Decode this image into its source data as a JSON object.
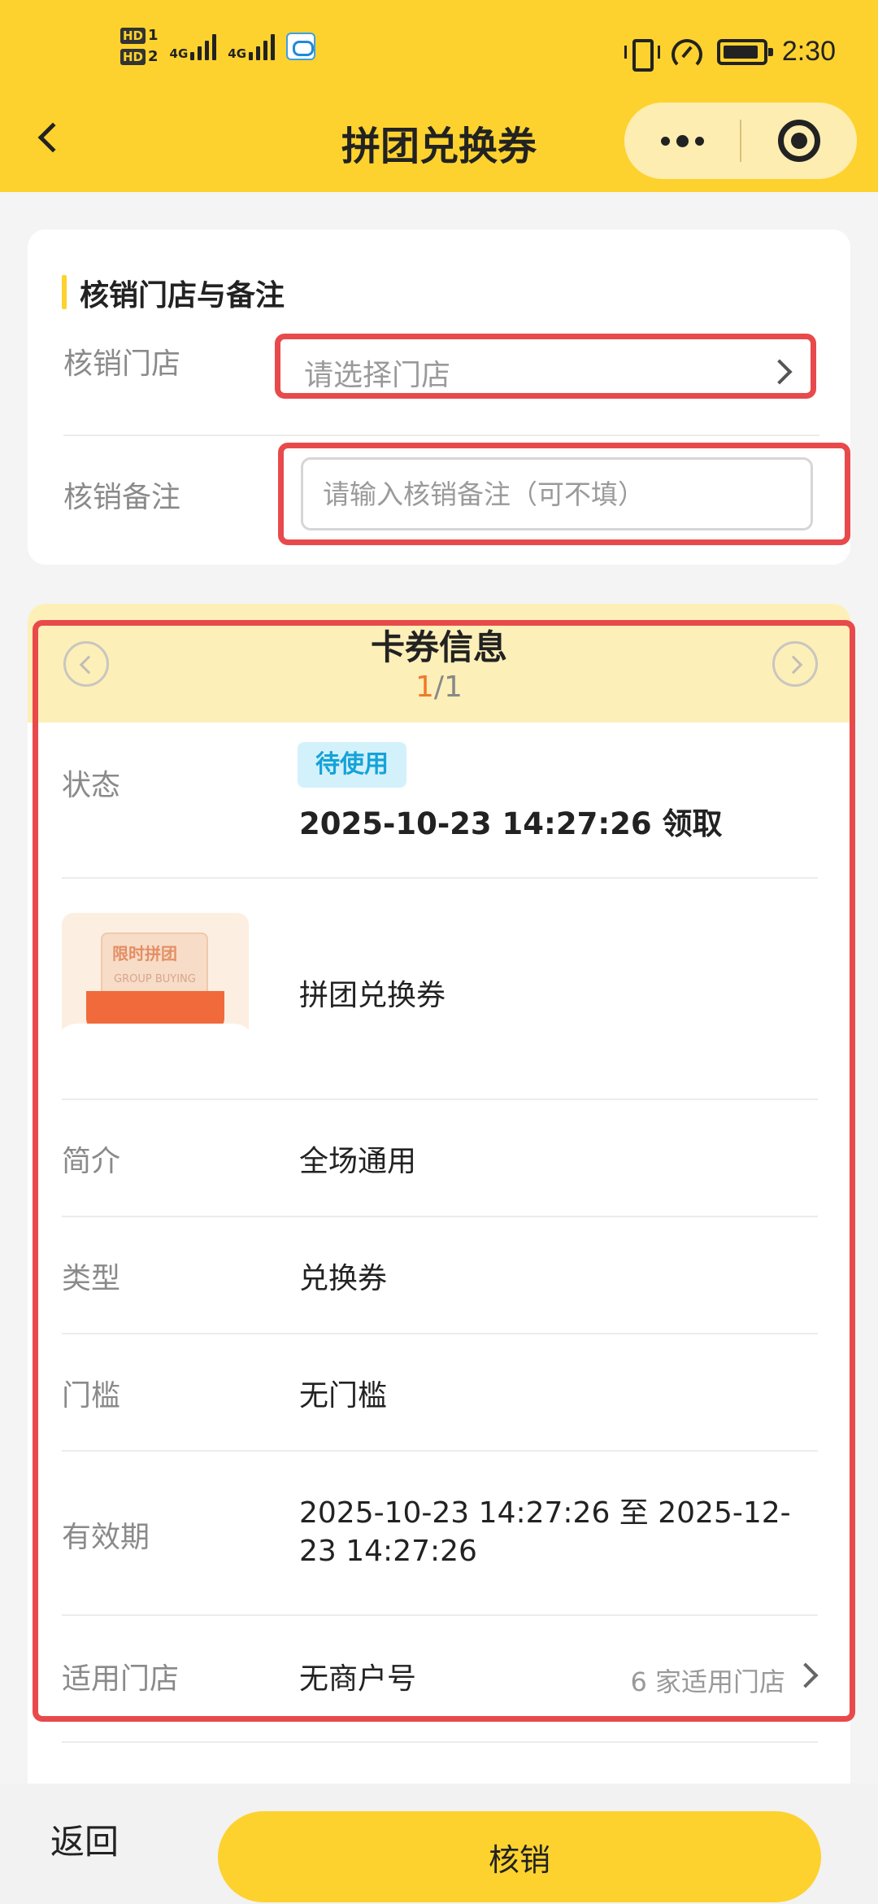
{
  "status_bar": {
    "hd1": "HD",
    "hd1_num": "1",
    "hd2": "HD",
    "hd2_num": "2",
    "net1": "4G",
    "net2": "4G",
    "time": "2:30",
    "icons": [
      "vibrate-icon",
      "speedometer-icon",
      "battery-icon"
    ]
  },
  "header": {
    "title": "拼团兑换券",
    "back_icon": "chevron-left-icon",
    "menu_icon": "more-dots-icon",
    "close_icon": "target-circle-icon",
    "background": "#fdd22e"
  },
  "verify_section": {
    "title": "核销门店与备注",
    "store_label": "核销门店",
    "store_placeholder": "请选择门店",
    "remark_label": "核销备注",
    "remark_placeholder": "请输入核销备注（可不填）",
    "remark_value": ""
  },
  "coupon_info": {
    "title": "卡券信息",
    "page_current": "1",
    "page_total": "/1",
    "status_label": "状态",
    "status_badge": "待使用",
    "received_time": "2025-10-23 14:27:26 领取",
    "image_title": "限时拼团",
    "image_subtitle": "GROUP BUYING",
    "coupon_name": "拼团兑换券",
    "intro_label": "简介",
    "intro_value": "全场通用",
    "type_label": "类型",
    "type_value": "兑换券",
    "threshold_label": "门槛",
    "threshold_value": "无门槛",
    "validity_label": "有效期",
    "validity_line1": "2025-10-23 14:27:26 至 2025-12-",
    "validity_line2": "23 14:27:26",
    "stores_label": "适用门店",
    "stores_value": "无商户号",
    "stores_link": "6 家适用门店"
  },
  "footer": {
    "back_label": "返回",
    "verify_label": "核销"
  },
  "colors": {
    "accent": "#fdd22e",
    "highlight": "#e84a4c",
    "badge_bg": "#d3f1fb",
    "badge_text": "#14a3d8",
    "pager_current": "#f07a2a"
  }
}
